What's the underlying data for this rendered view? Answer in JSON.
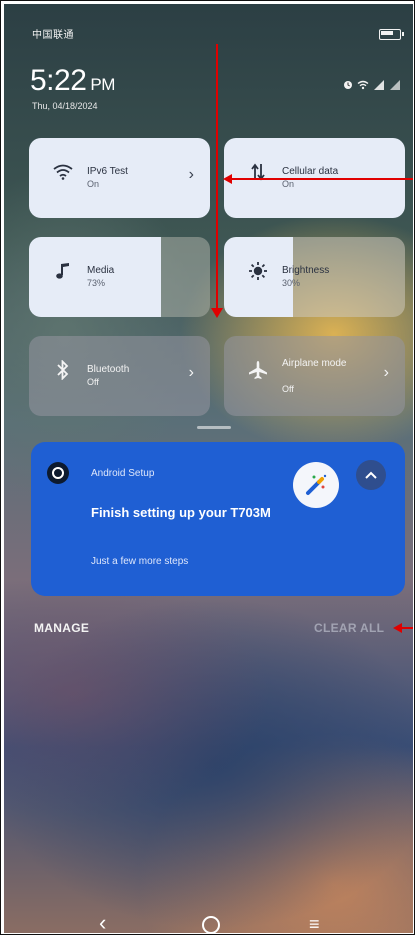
{
  "status_bar": {
    "carrier": "中国联通",
    "battery_level": 0.6,
    "icons": [
      "alarm-icon",
      "wifi-icon",
      "signal-icon",
      "signal-icon"
    ]
  },
  "clock": {
    "time": "5:22",
    "ampm": "PM",
    "date": "Thu, 04/18/2024"
  },
  "tiles": [
    {
      "name": "IPv6 Test",
      "value": "On",
      "icon": "wifi-icon",
      "state": "on",
      "has_chevron": true
    },
    {
      "name": "Cellular data",
      "value": "On",
      "icon": "mobile-data-icon",
      "state": "on",
      "has_chevron": false
    },
    {
      "name": "Media",
      "value": "73%",
      "icon": "music-note-icon",
      "state": "slider",
      "level": 0.73
    },
    {
      "name": "Brightness",
      "value": "30%",
      "icon": "brightness-icon",
      "state": "slider",
      "level": 0.3
    },
    {
      "name": "Bluetooth",
      "value": "Off",
      "icon": "bluetooth-icon",
      "state": "off",
      "has_chevron": true
    },
    {
      "name": "Airplane mode",
      "value": "Off",
      "icon": "airplane-icon",
      "state": "off",
      "has_chevron": true
    }
  ],
  "notification": {
    "app_name": "Android Setup",
    "title": "Finish setting up your T703M",
    "subtitle": "Just a few more steps",
    "background": "#1f5fd3"
  },
  "actions": {
    "manage": "MANAGE",
    "clear_all": "CLEAR ALL"
  },
  "colors": {
    "annotation": "#e00000",
    "tile_on": "#e6ecf7",
    "tile_off": "#96969f"
  }
}
